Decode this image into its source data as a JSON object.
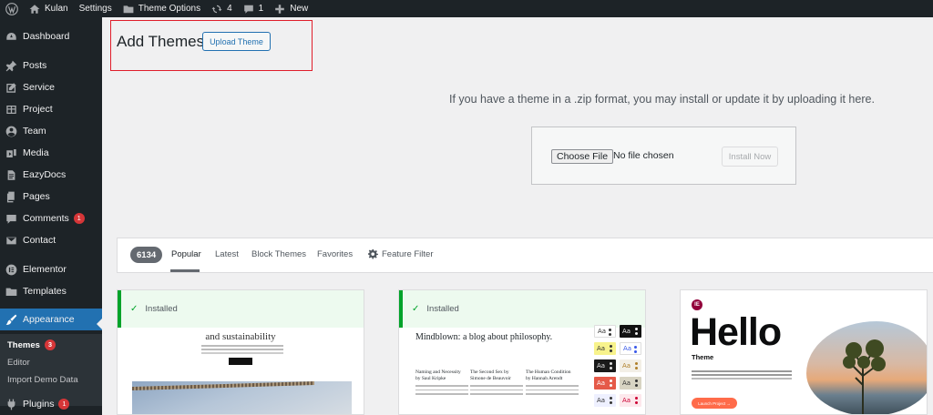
{
  "adminbar": {
    "site_name": "Kulan",
    "settings": "Settings",
    "theme_options": "Theme Options",
    "updates_count": "4",
    "comments_count": "1",
    "new_label": "New"
  },
  "sidebar": {
    "items": [
      {
        "label": "Dashboard",
        "icon": "dashboard-icon"
      },
      {
        "label": "Posts",
        "icon": "pushpin-icon"
      },
      {
        "label": "Service",
        "icon": "edit-icon"
      },
      {
        "label": "Project",
        "icon": "table-icon"
      },
      {
        "label": "Team",
        "icon": "user-circle-icon"
      },
      {
        "label": "Media",
        "icon": "media-icon"
      },
      {
        "label": "EazyDocs",
        "icon": "document-icon"
      },
      {
        "label": "Pages",
        "icon": "page-icon"
      },
      {
        "label": "Comments",
        "icon": "comment-icon",
        "badge": "1"
      },
      {
        "label": "Contact",
        "icon": "mail-icon"
      },
      {
        "label": "Elementor",
        "icon": "elementor-icon"
      },
      {
        "label": "Templates",
        "icon": "folder-icon"
      },
      {
        "label": "Appearance",
        "icon": "brush-icon"
      },
      {
        "label": "Plugins",
        "icon": "plugin-icon",
        "badge": "1"
      }
    ],
    "submenu": [
      {
        "label": "Themes",
        "badge": "3"
      },
      {
        "label": "Editor"
      },
      {
        "label": "Import Demo Data"
      }
    ]
  },
  "header": {
    "title": "Add Themes",
    "upload_button": "Upload Theme"
  },
  "upload": {
    "help_text": "If you have a theme in a .zip format, you may install or update it by uploading it here.",
    "choose_file": "Choose File",
    "no_file": "No file chosen",
    "install_now": "Install Now"
  },
  "filter": {
    "count": "6134",
    "tabs": [
      "Popular",
      "Latest",
      "Block Themes",
      "Favorites"
    ],
    "feature_filter": "Feature Filter"
  },
  "themes": [
    {
      "status": "Installed",
      "preview_heading": "and sustainability"
    },
    {
      "status": "Installed",
      "preview_title": "Mindblown: a blog about philosophy.",
      "posts": [
        {
          "title": "Naming and Necessity",
          "author": "by Saul Kripke"
        },
        {
          "title": "The Second Sex by",
          "author": "Simone de Beauvoir"
        },
        {
          "title": "The Human Condition",
          "author": "by Hannah Arendt"
        }
      ],
      "swatch_label": "Aa"
    },
    {
      "preview_heading": "Hello",
      "preview_sub": "Theme",
      "preview_button": "Launch Project →",
      "logo": "IE"
    }
  ],
  "colors": {
    "admin_dark": "#1d2327",
    "accent": "#2271b1",
    "badge": "#d63638",
    "installed": "#00a32a",
    "highlight": "#e01e2b"
  }
}
